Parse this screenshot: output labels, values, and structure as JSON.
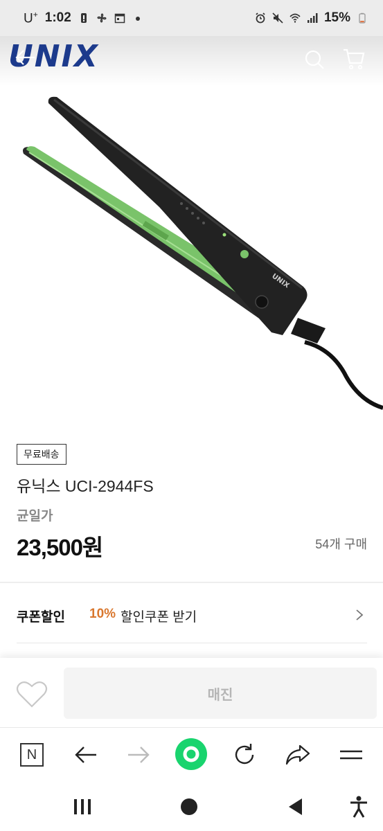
{
  "status_bar": {
    "carrier": "U",
    "carrier_sup": "+",
    "time": "1:02",
    "battery": "15%",
    "icons": [
      "battery-alert-icon",
      "fan-icon",
      "calendar-icon",
      "dot-icon",
      "alarm-icon",
      "mute-icon",
      "wifi-icon",
      "signal-icon",
      "battery-icon"
    ]
  },
  "header": {
    "logo": "UNIX",
    "icons": [
      "back-arrow-icon",
      "search-icon",
      "cart-icon"
    ]
  },
  "product": {
    "badge": "무료배송",
    "name": "유닉스 UCI-2944FS",
    "price_label": "균일가",
    "price": "23,500원",
    "purchase_count": "54개 구매"
  },
  "coupon": {
    "title": "쿠폰할인",
    "percent": "10%",
    "text": "할인쿠폰 받기"
  },
  "action_bar": {
    "button_label": "매진"
  },
  "browser_toolbar": {
    "n_label": "N",
    "icons": [
      "naver-n-icon",
      "back-icon",
      "forward-icon",
      "green-home-icon",
      "reload-icon",
      "share-icon",
      "menu-icon"
    ]
  },
  "colors": {
    "logo": "#1c3a8c",
    "coupon_percent": "#d9772e",
    "green_button": "#19d46e",
    "soldout_text": "#b5b5b5"
  }
}
